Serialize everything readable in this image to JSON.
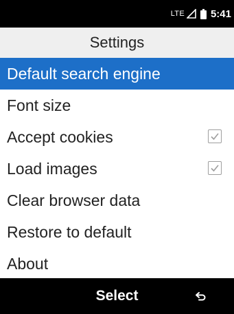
{
  "status_bar": {
    "network": "LTE",
    "time": "5:41",
    "signal_icon": "signal-icon",
    "battery_icon": "battery-icon"
  },
  "header": {
    "title": "Settings"
  },
  "menu": {
    "items": [
      {
        "label": "Default search engine",
        "selected": true
      },
      {
        "label": "Font size"
      },
      {
        "label": "Accept cookies",
        "checked": true
      },
      {
        "label": "Load images",
        "checked": true
      },
      {
        "label": "Clear browser data"
      },
      {
        "label": "Restore to default"
      },
      {
        "label": "About"
      }
    ]
  },
  "softkeys": {
    "center": "Select",
    "right_icon": "back-arrow-icon"
  },
  "colors": {
    "selection": "#1d6fc8",
    "bars": "#000000",
    "header_bg": "#efefef"
  }
}
